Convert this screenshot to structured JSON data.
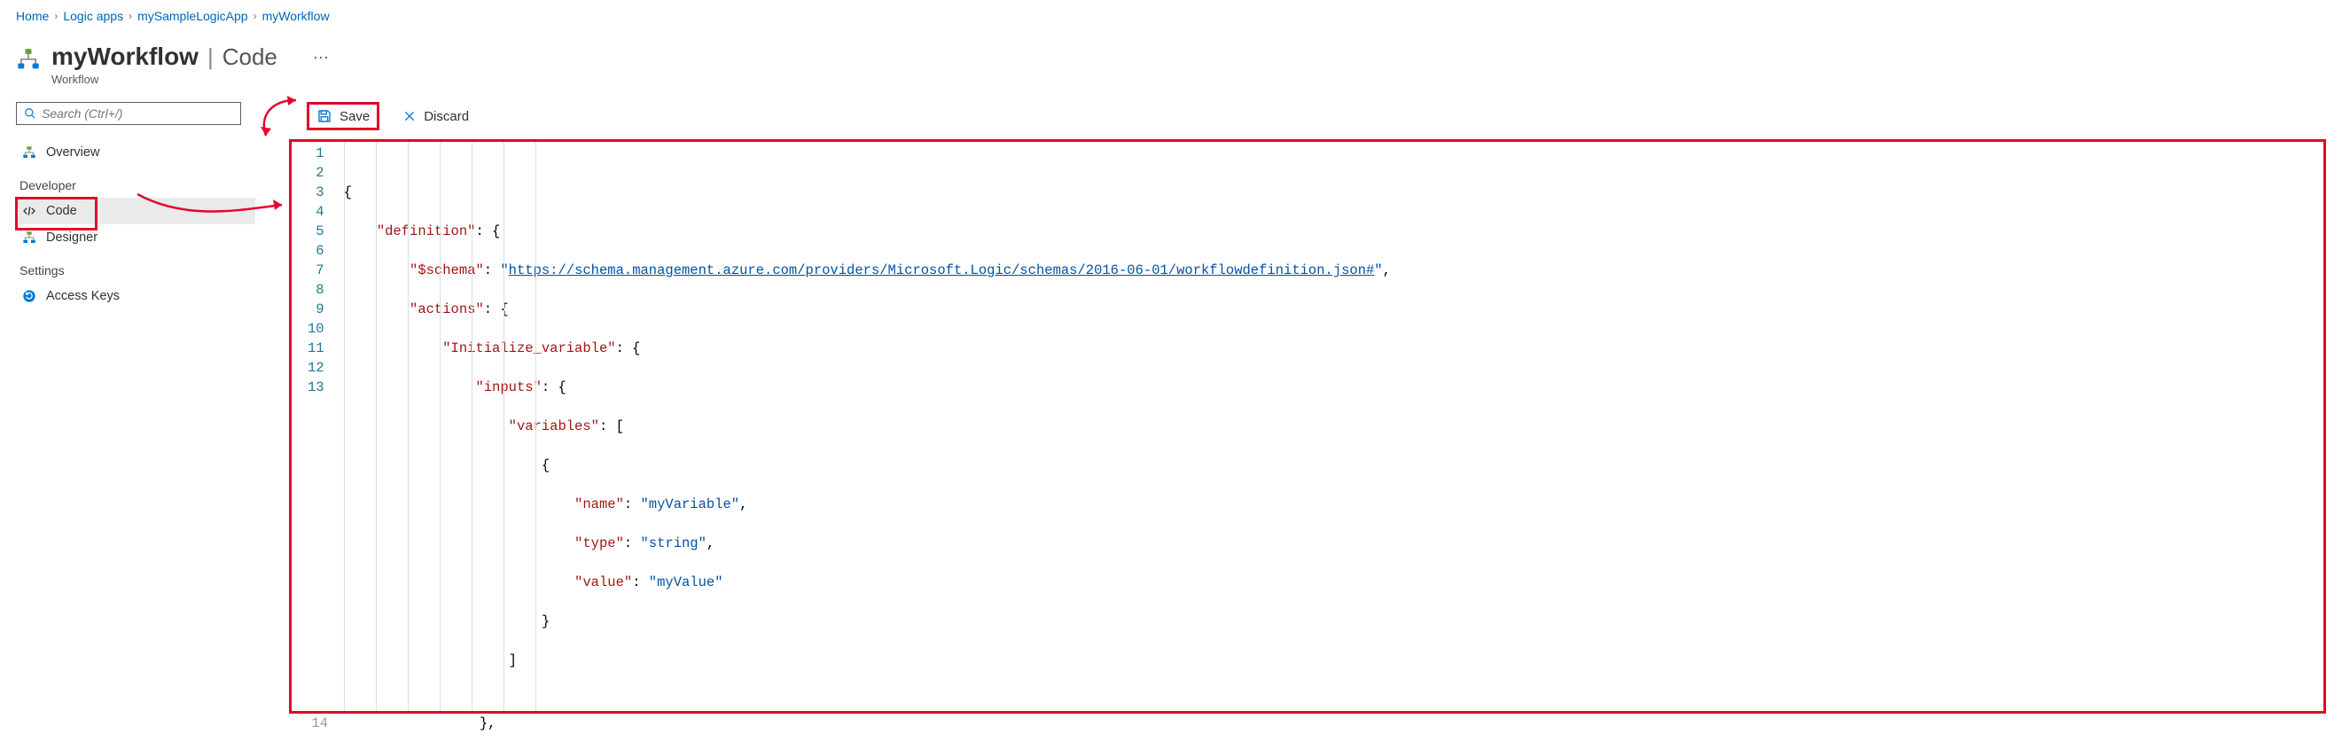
{
  "breadcrumb": {
    "items": [
      "Home",
      "Logic apps",
      "mySampleLogicApp",
      "myWorkflow"
    ]
  },
  "header": {
    "name": "myWorkflow",
    "suffix": "Code",
    "subtitle": "Workflow",
    "ellipsis": "···"
  },
  "sidebar": {
    "search_placeholder": "Search (Ctrl+/)",
    "overview": "Overview",
    "heading_developer": "Developer",
    "code": "Code",
    "designer": "Designer",
    "heading_settings": "Settings",
    "access_keys": "Access Keys"
  },
  "toolbar": {
    "save": "Save",
    "discard": "Discard"
  },
  "editor": {
    "line_numbers": [
      "1",
      "2",
      "3",
      "4",
      "5",
      "6",
      "7",
      "8",
      "9",
      "10",
      "11",
      "12",
      "13"
    ],
    "extra_line_number": "14",
    "code": {
      "l1": "{",
      "l2_key": "\"definition\"",
      "l2_rest": ": {",
      "l3_key": "\"$schema\"",
      "l3_sep": ": ",
      "l3_url": "https://schema.management.azure.com/providers/Microsoft.Logic/schemas/2016-06-01/workflowdefinition.json#",
      "l3_end": ",",
      "l4_key": "\"actions\"",
      "l4_rest": ": {",
      "l5_key": "\"Initialize_variable\"",
      "l5_rest": ": {",
      "l6_key": "\"inputs\"",
      "l6_rest": ": {",
      "l7_key": "\"variables\"",
      "l7_rest": ": [",
      "l8": "{",
      "l9_key": "\"name\"",
      "l9_sep": ": ",
      "l9_val": "\"myVariable\"",
      "l9_end": ",",
      "l10_key": "\"type\"",
      "l10_sep": ": ",
      "l10_val": "\"string\"",
      "l10_end": ",",
      "l11_key": "\"value\"",
      "l11_sep": ": ",
      "l11_val": "\"myValue\"",
      "l12": "}",
      "l13": "]",
      "l14": "},"
    }
  }
}
